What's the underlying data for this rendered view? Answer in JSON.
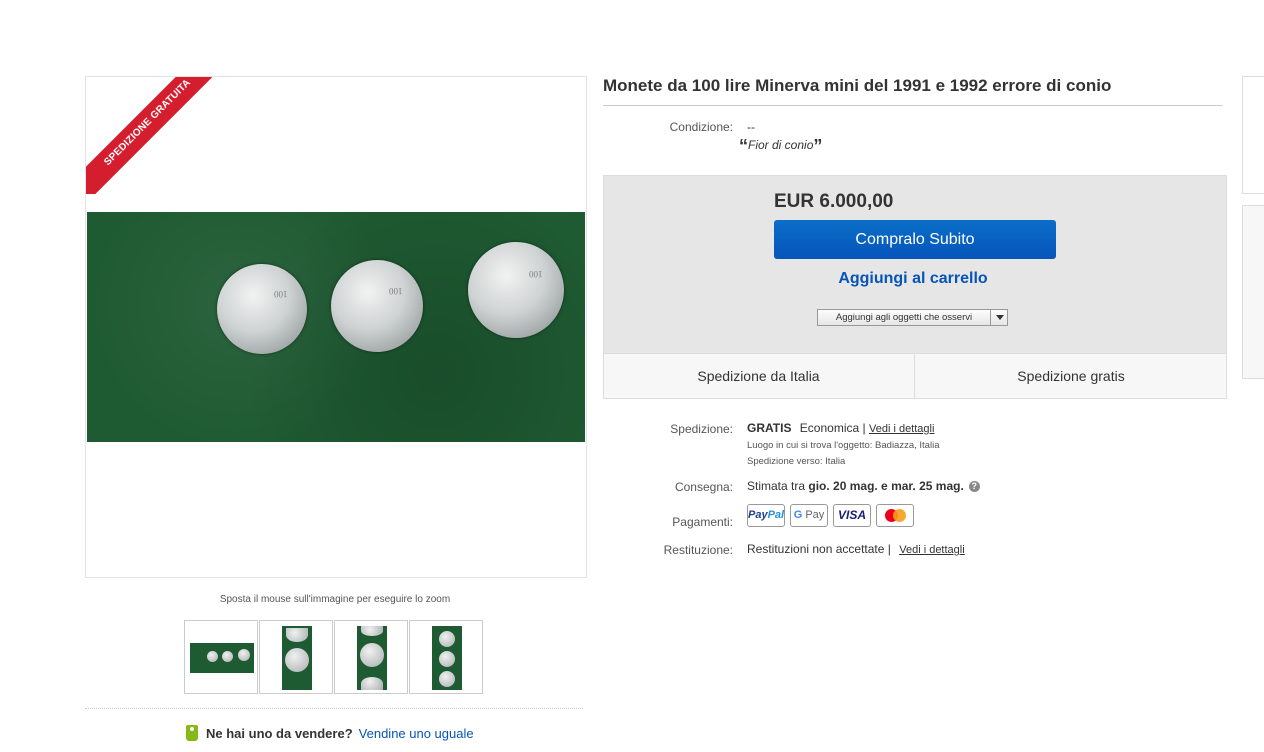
{
  "listing": {
    "title": "Monete da 100 lire Minerva mini del 1991 e 1992 errore di conio",
    "badge": "SPEDIZIONE GRATUITA",
    "coin_mark": "100",
    "zoom_hint": "Sposta il mouse sull'immagine per eseguire lo zoom",
    "thumbnails_count": 4,
    "sell_question": "Ne hai uno da vendere?",
    "sell_link": "Vendine uno uguale"
  },
  "condition": {
    "label": "Condizione:",
    "value": "--",
    "description": "Fior di conio",
    "open_quote": "“",
    "close_quote": "”"
  },
  "buy": {
    "price": "EUR 6.000,00",
    "buy_now": "Compralo Subito",
    "add_to_cart": "Aggiungi al carrello",
    "watch": "Aggiungi agli oggetti che osservi",
    "ship_from": "Spedizione da Italia",
    "ship_free": "Spedizione gratis"
  },
  "shipping": {
    "label": "Spedizione:",
    "cost": "GRATIS",
    "method": "Economica",
    "separator": "|",
    "details_link": "Vedi i dettagli",
    "location_label": "Luogo in cui si trova l'oggetto:",
    "location": "Badiazza, Italia",
    "ships_to_label": "Spedizione verso:",
    "ships_to": "Italia"
  },
  "delivery": {
    "label": "Consegna:",
    "prefix": "Stimata tra",
    "dates": "gio. 20 mag. e mar. 25 mag.",
    "help": "?"
  },
  "payments": {
    "label": "Pagamenti:",
    "methods": [
      "PayPal",
      "G Pay",
      "VISA",
      "Mastercard"
    ],
    "paypal_a": "Pay",
    "paypal_b": "Pal",
    "gpay_g": "G",
    "gpay_pay": " Pay",
    "visa": "VISA"
  },
  "returns": {
    "label": "Restituzione:",
    "value": "Restituzioni non accettate",
    "separator": "|",
    "details_link": "Vedi i dettagli"
  },
  "colors": {
    "buy_button": "#0654ba",
    "badge": "#d41e2d",
    "photo_bg": "#1e5a32"
  }
}
